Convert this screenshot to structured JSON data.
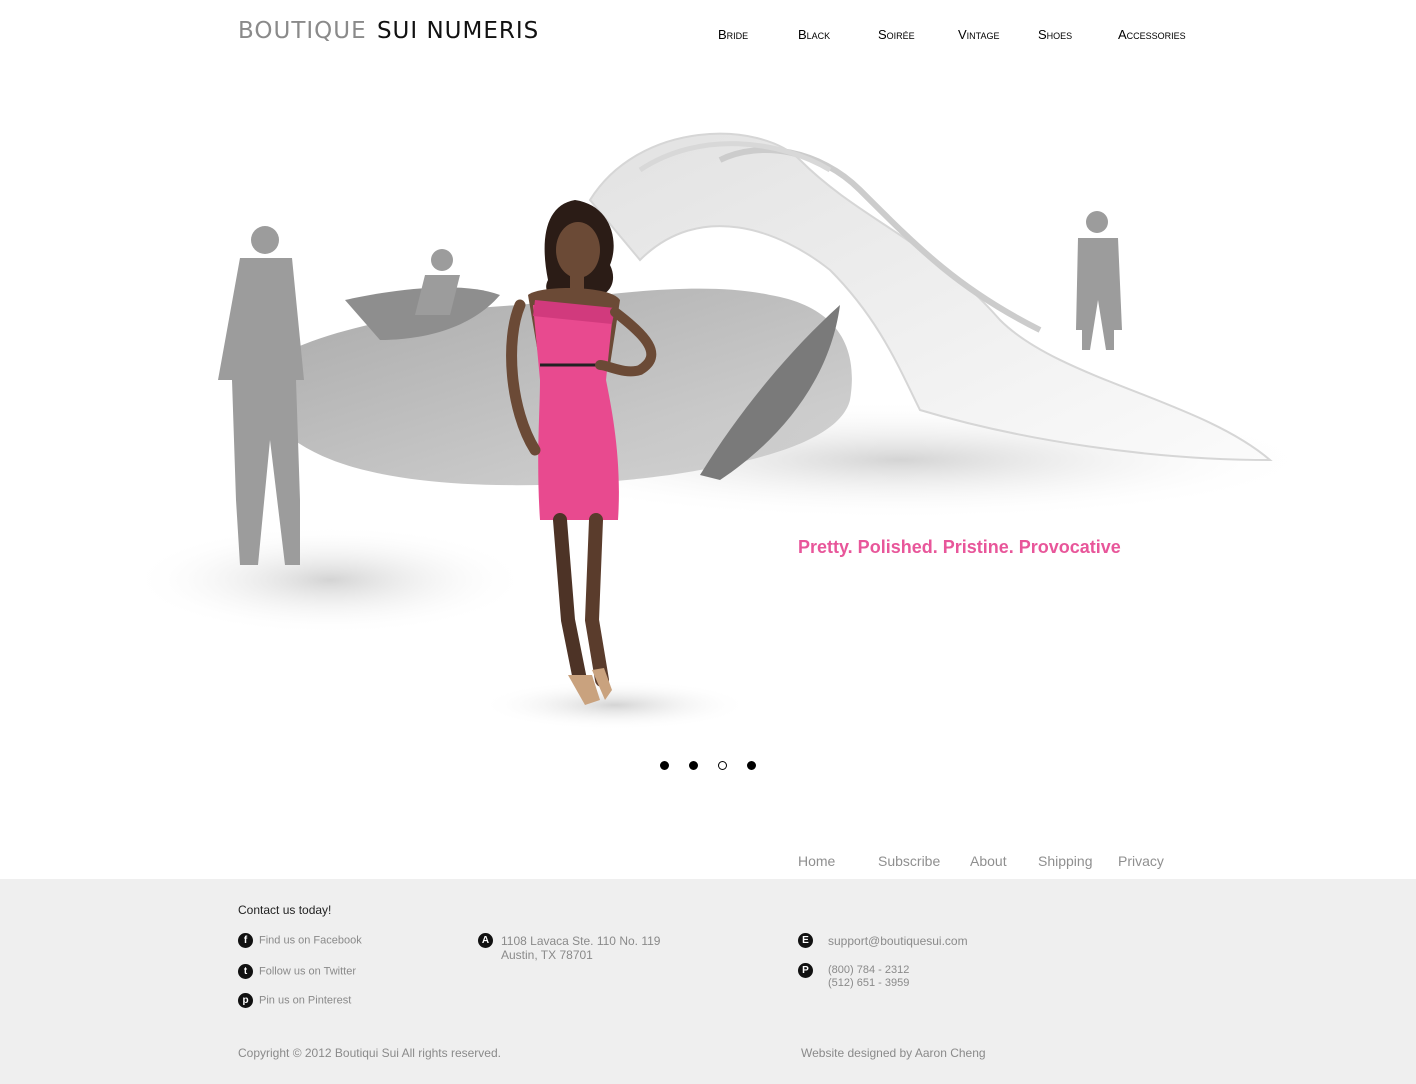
{
  "header": {
    "logo_light": "BOUTIQUE",
    "logo_dark": "SUI NUMERIS",
    "nav": [
      "Bride",
      "Black",
      "Soirée",
      "Vintage",
      "Shoes",
      "Accessories"
    ]
  },
  "hero": {
    "tagline": "Pretty. Polished. Pristine. Provocative",
    "image": "fashion-model-pink-dress-showroom",
    "slides": [
      {
        "active": false
      },
      {
        "active": false
      },
      {
        "active": true
      },
      {
        "active": false
      }
    ]
  },
  "footer_nav": [
    "Home",
    "Subscribe",
    "About",
    "Shipping",
    "Privacy"
  ],
  "footer": {
    "contact_title": "Contact us today!",
    "social": [
      {
        "icon": "facebook-icon",
        "glyph": "f",
        "label": "Find us on Facebook"
      },
      {
        "icon": "twitter-icon",
        "glyph": "t",
        "label": "Follow us on Twitter"
      },
      {
        "icon": "pinterest-icon",
        "glyph": "p",
        "label": "Pin us on Pinterest"
      }
    ],
    "address": {
      "glyph": "A",
      "line1": "1108 Lavaca Ste. 110 No. 119",
      "line2": "Austin, TX 78701"
    },
    "email": {
      "glyph": "E",
      "value": "support@boutiquesui.com"
    },
    "phone": {
      "glyph": "P",
      "line1": "(800) 784 - 2312",
      "line2": "(512) 651 - 3959"
    },
    "copyright": "Copyright © 2012 Boutiqui Sui All rights reserved.",
    "credit": "Website designed by  Aaron Cheng"
  },
  "colors": {
    "accent": "#e8569a",
    "footer_bg": "#efefef",
    "muted_text": "#8a8a8a"
  }
}
